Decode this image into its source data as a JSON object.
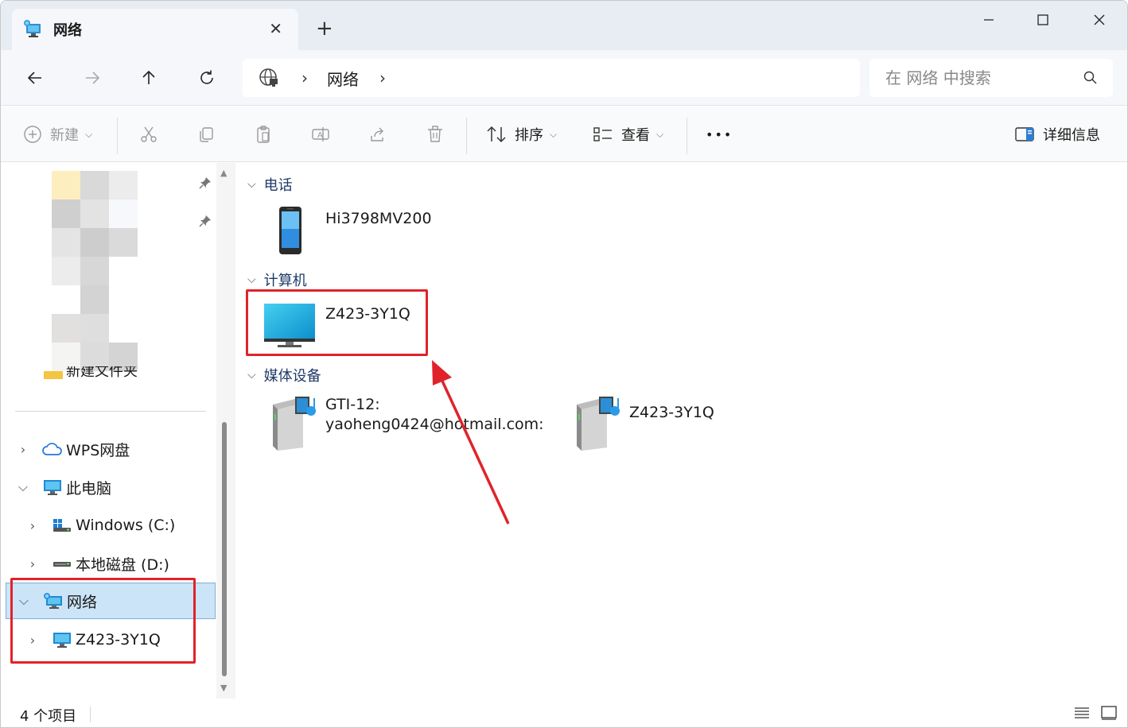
{
  "tab": {
    "title": "网络",
    "close": "✕",
    "new_tab": "+"
  },
  "window_controls": {
    "minimize": "—",
    "maximize": "☐",
    "close": "✕"
  },
  "nav": {
    "back": "←",
    "forward": "→",
    "up": "↑",
    "refresh": "⟳"
  },
  "address": {
    "separator": "›",
    "crumb": "网络",
    "trailing_separator": "›"
  },
  "search": {
    "placeholder": "在 网络 中搜索"
  },
  "commands": {
    "new": "新建",
    "sort": "排序",
    "view": "查看",
    "more": "•••",
    "details": "详细信息"
  },
  "sidebar": {
    "quick_access_partial": "新建文件夹",
    "items": [
      {
        "label": "WPS网盘",
        "expanded": false
      },
      {
        "label": "此电脑",
        "expanded": true
      },
      {
        "label": "Windows (C:)",
        "expanded": false
      },
      {
        "label": "本地磁盘 (D:)",
        "expanded": false
      },
      {
        "label": "网络",
        "expanded": true,
        "selected": true
      },
      {
        "label": "Z423-3Y1Q",
        "expanded": false
      }
    ]
  },
  "groups": {
    "phone": {
      "title": "电话",
      "items": [
        {
          "name": "Hi3798MV200"
        }
      ]
    },
    "computer": {
      "title": "计算机",
      "items": [
        {
          "name": "Z423-3Y1Q"
        }
      ]
    },
    "media": {
      "title": "媒体设备",
      "items": [
        {
          "name_line1": "GTI-12:",
          "name_line2": "yaoheng0424@hotmail.com:"
        },
        {
          "name": "Z423-3Y1Q"
        }
      ]
    }
  },
  "status": {
    "count": "4 个项目"
  },
  "colors": {
    "annotation": "#e0232b",
    "selection": "#cce4f7",
    "group_header": "#1f3a68"
  }
}
